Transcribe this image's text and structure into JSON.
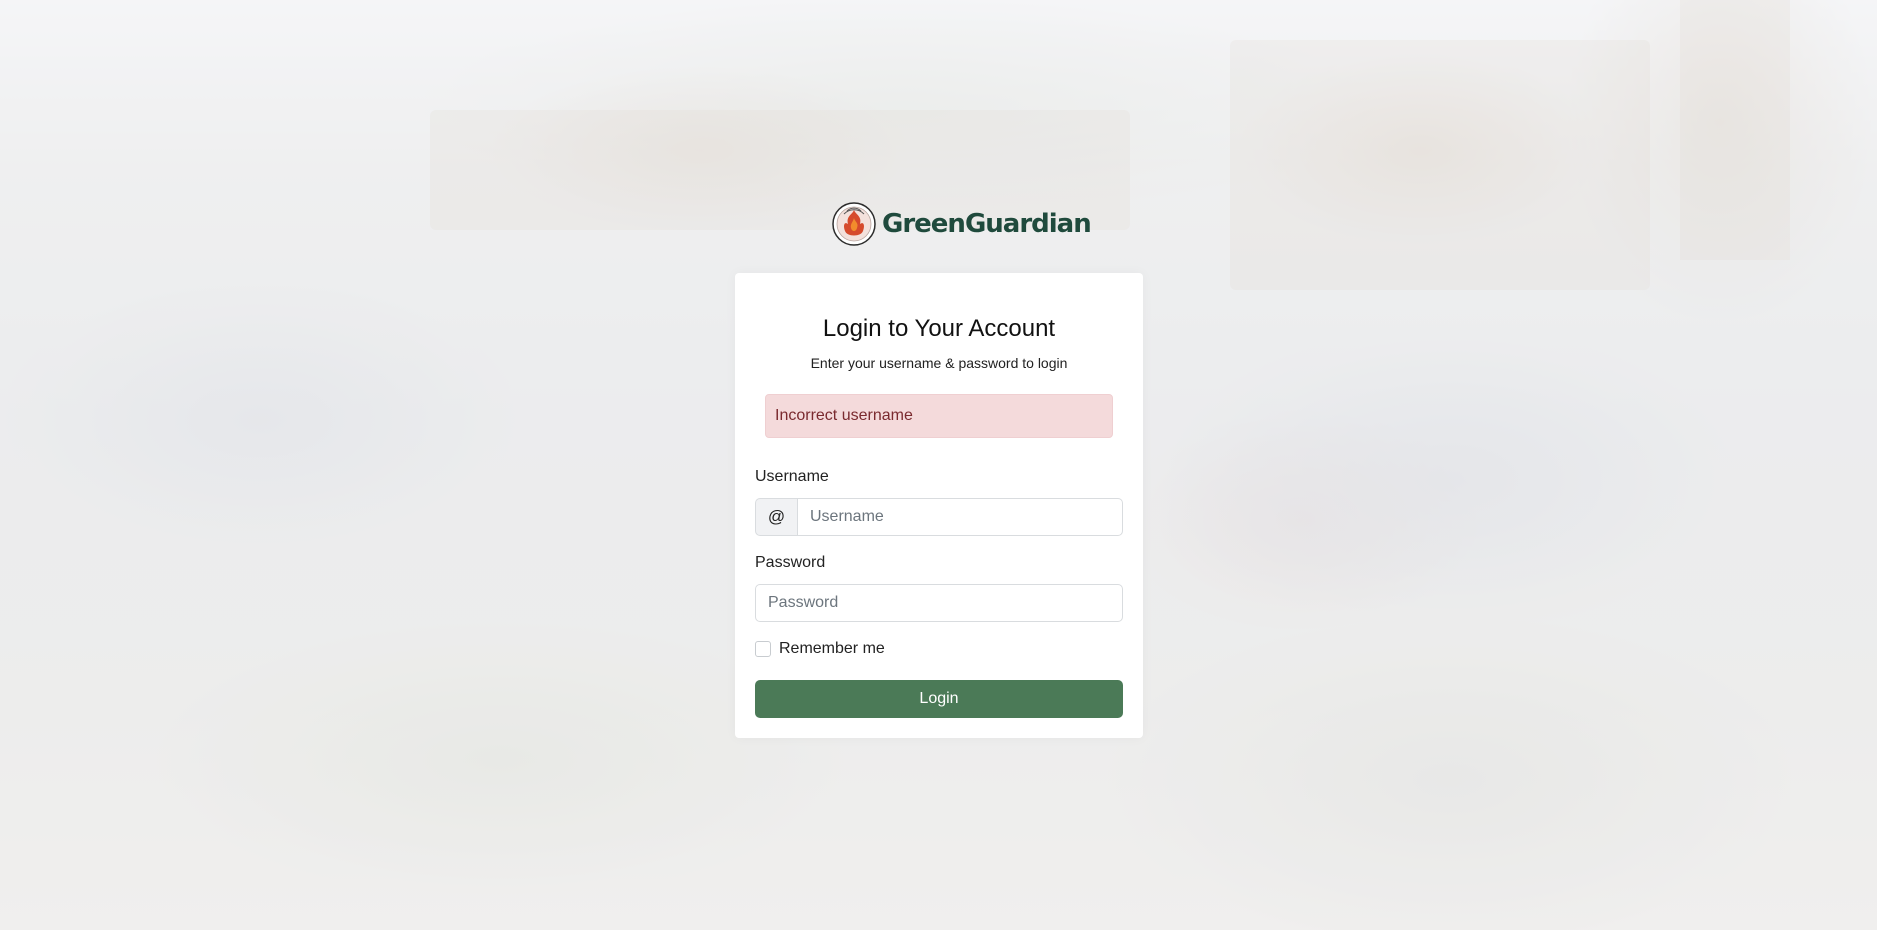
{
  "brand": {
    "name": "GreenGuardian",
    "logo_icon": "flame-emblem-icon",
    "name_color": "#1f4a3c"
  },
  "login": {
    "title": "Login to Your Account",
    "subtitle": "Enter your username & password to login",
    "error_message": "Incorrect username",
    "username": {
      "label": "Username",
      "prefix": "@",
      "value": "",
      "placeholder": "Username"
    },
    "password": {
      "label": "Password",
      "value": "",
      "placeholder": "Password"
    },
    "remember_me": {
      "label": "Remember me",
      "checked": false
    },
    "submit_label": "Login"
  },
  "colors": {
    "primary_button": "#4b7a57",
    "alert_background": "#f4dadb",
    "alert_text": "#7a2a2f"
  }
}
